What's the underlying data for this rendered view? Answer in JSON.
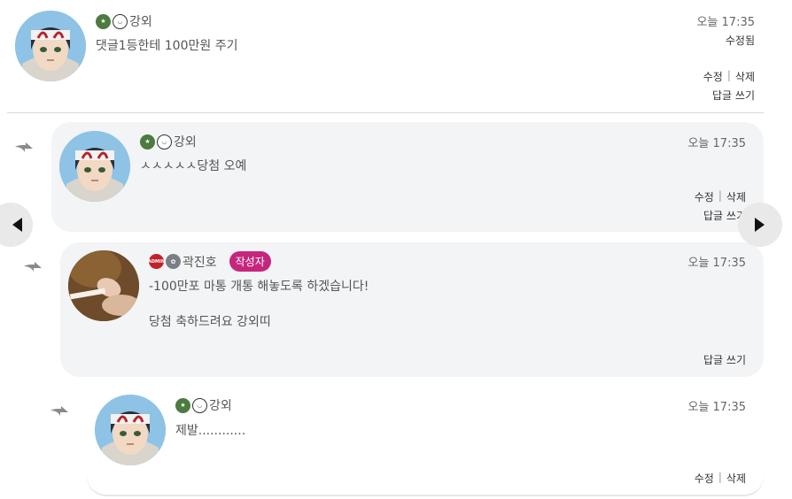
{
  "comments": [
    {
      "username": "강외",
      "time": "오늘 17:35",
      "edited": "수정됨",
      "text": "댓글1등한테 100만원 주기",
      "edit_label": "수정",
      "delete_label": "삭제",
      "reply_label": "답글 쓰기"
    },
    {
      "username": "강외",
      "time": "오늘 17:35",
      "text": "ㅅㅅㅅㅅㅅ당첨 오예",
      "edit_label": "수정",
      "delete_label": "삭제",
      "reply_label": "답글 쓰기"
    },
    {
      "username": "곽진호",
      "author_tag": "작성자",
      "time": "오늘 17:35",
      "text": "-100만포 마통 개통 해놓도록 하겠습니다!\n\n당첨 축하드려요 강외띠",
      "reply_label": "답글 쓰기"
    },
    {
      "username": "강외",
      "time": "오늘 17:35",
      "text": "제발............",
      "edit_label": "수정",
      "delete_label": "삭제"
    }
  ],
  "icons": {
    "prev": "triangle-left-icon",
    "next": "triangle-right-icon",
    "reply": "reply-arrow-icon"
  },
  "colors": {
    "author_tag": "#c6257d",
    "card_bg": "#f3f4f6"
  }
}
